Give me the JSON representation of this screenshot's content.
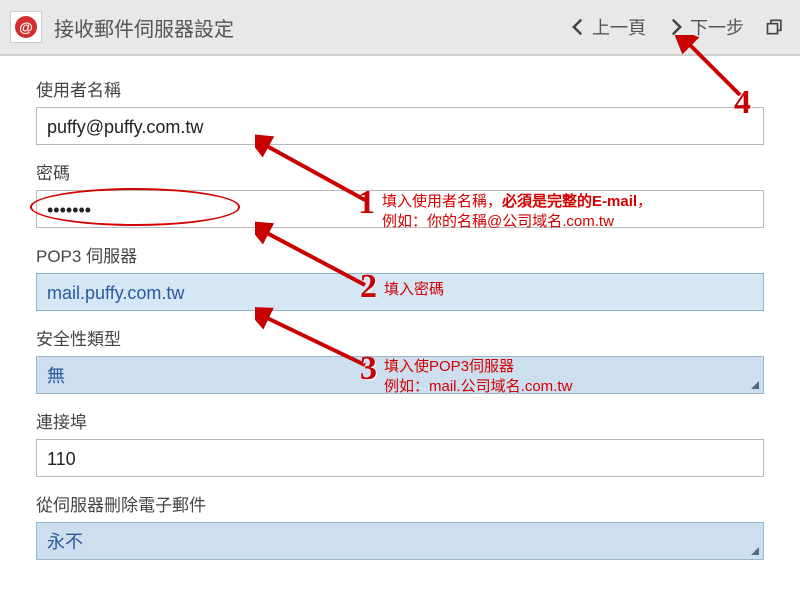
{
  "header": {
    "title": "接收郵件伺服器設定",
    "prev": "上一頁",
    "next": "下一步"
  },
  "fields": {
    "username": {
      "label": "使用者名稱",
      "value": "puffy@puffy.com.tw"
    },
    "password": {
      "label": "密碼",
      "value": "•••••••"
    },
    "pop3": {
      "label": "POP3 伺服器",
      "value": "mail.puffy.com.tw"
    },
    "security": {
      "label": "安全性類型",
      "value": "無"
    },
    "port": {
      "label": "連接埠",
      "value": "110"
    },
    "delete": {
      "label": "從伺服器刪除電子郵件",
      "value": "永不"
    }
  },
  "annotations": {
    "n1": "1",
    "n2": "2",
    "n3": "3",
    "n4": "4",
    "t1a": "填入使用者名稱，",
    "t1b": "必須是完整的E-mail",
    "t1c": "，",
    "t1d": "例如：你的名稱@公司域名.com.tw",
    "t2": "填入密碼",
    "t3a": "填入使POP3伺服器",
    "t3b": "例如：mail.公司域名.com.tw"
  },
  "colors": {
    "annotation_red": "#d40000",
    "header_bg": "#e8e8e8",
    "select_bg": "#cddfef"
  }
}
